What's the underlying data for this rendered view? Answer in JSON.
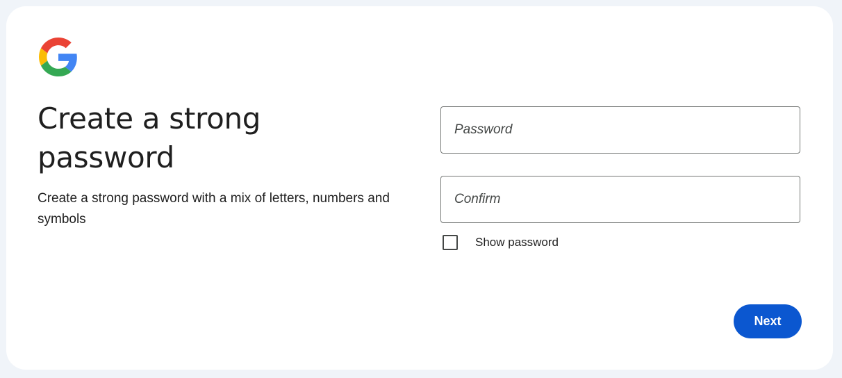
{
  "brand": {
    "logo_icon": "google-g-icon",
    "colors": {
      "blue": "#4285F4",
      "red": "#EA4335",
      "yellow": "#FBBC05",
      "green": "#34A853"
    }
  },
  "heading": {
    "title": "Create a strong password",
    "subtitle": "Create a strong password with a mix of letters, numbers and symbols"
  },
  "form": {
    "password": {
      "placeholder": "Password",
      "value": ""
    },
    "confirm": {
      "placeholder": "Confirm",
      "value": ""
    },
    "show_password": {
      "label": "Show password",
      "checked": false
    }
  },
  "actions": {
    "next_label": "Next"
  },
  "theme": {
    "page_background": "#f0f4f9",
    "card_background": "#ffffff",
    "primary": "#0b57d0",
    "text": "#1f1f1f",
    "field_border": "#747775"
  }
}
